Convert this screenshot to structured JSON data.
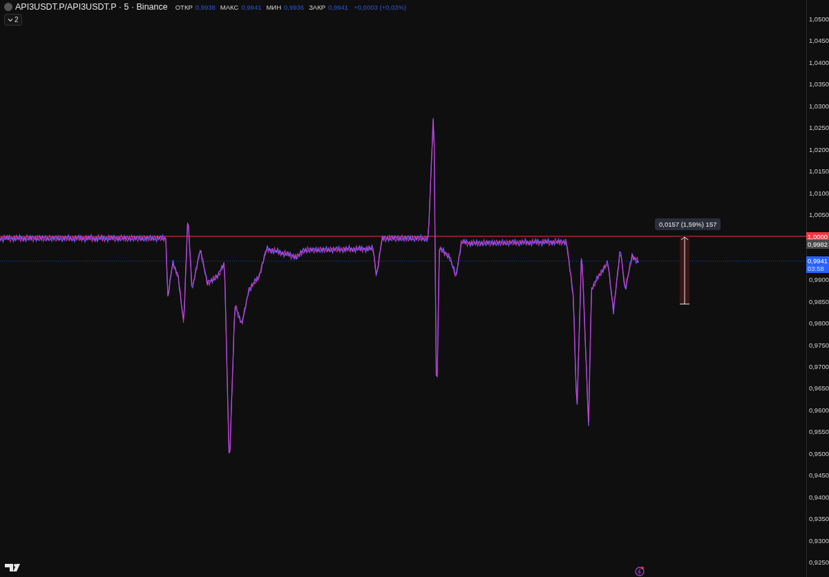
{
  "header": {
    "symbol": "API3USDT.P/API3USDT.P · 5 · Binance",
    "ohlc": [
      {
        "label": "ОТКР",
        "value": "0,9938"
      },
      {
        "label": "МАКС",
        "value": "0,9941"
      },
      {
        "label": "МИН",
        "value": "0,9936"
      },
      {
        "label": "ЗАКР",
        "value": "0,9941"
      }
    ],
    "change": "+0,0003 (+0,03%)"
  },
  "indicators_toggle": {
    "count": "2"
  },
  "measure": {
    "label": "0,0157 (1,59%) 157"
  },
  "price_axis": {
    "ticks_upper": [
      "1,0500",
      "1,0450",
      "1,0400",
      "1,0350",
      "1,0300",
      "1,0250",
      "1,0200",
      "1,0150",
      "1,0100",
      "1,0050"
    ],
    "ticks_lower": [
      "0,9900",
      "0,9850",
      "0,9800",
      "0,9750",
      "0,9700",
      "0,9650",
      "0,9600",
      "0,9550",
      "0,9500",
      "0,9450",
      "0,9400",
      "0,9350",
      "0,9300",
      "0,9250"
    ]
  },
  "price_labels": [
    {
      "kind": "alert",
      "text": "1,0000"
    },
    {
      "kind": "level",
      "text": "0,9982"
    },
    {
      "kind": "last",
      "text": "0,9941",
      "countdown": "03:58"
    }
  ]
}
